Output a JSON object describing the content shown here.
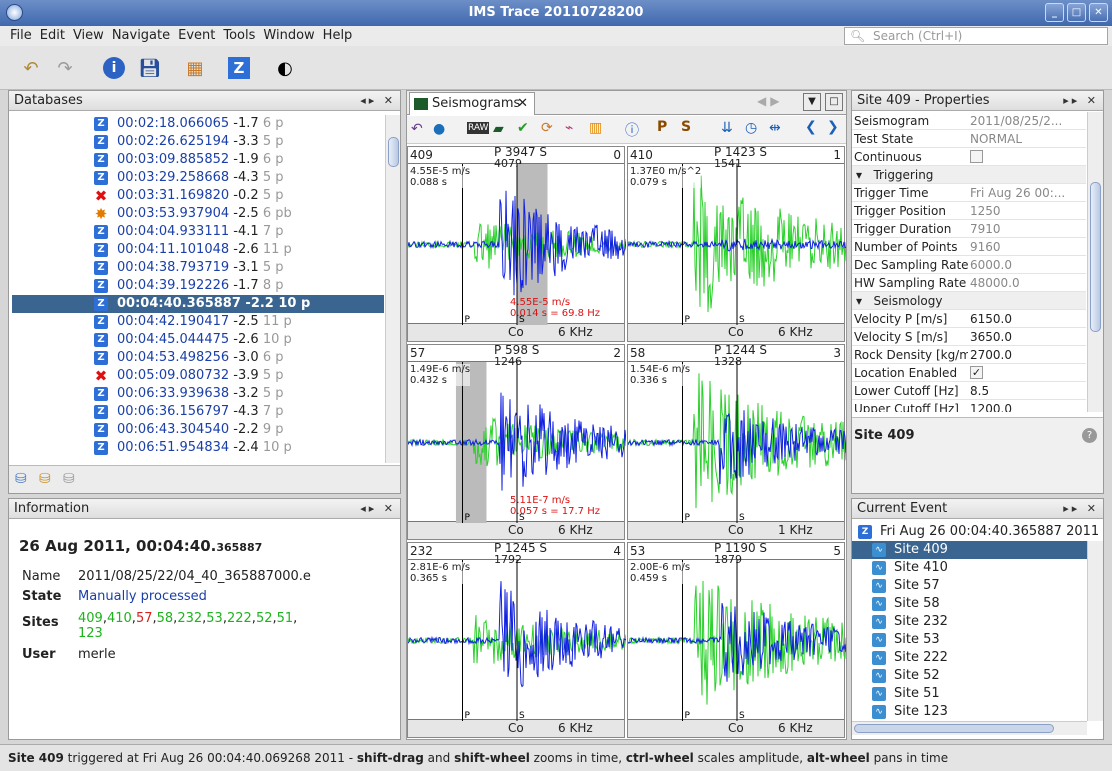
{
  "window": {
    "title": "IMS Trace 20110728200"
  },
  "menu": [
    "File",
    "Edit",
    "View",
    "Navigate",
    "Event",
    "Tools",
    "Window",
    "Help"
  ],
  "search": {
    "placeholder": "Search (Ctrl+I)"
  },
  "databases": {
    "title": "Databases",
    "rows": [
      {
        "time": "00:02:18.066065",
        "mag": "-1.7",
        "count": "6 p",
        "icon": "z"
      },
      {
        "time": "00:02:26.625194",
        "mag": "-3.3",
        "count": "5 p",
        "icon": "z"
      },
      {
        "time": "00:03:09.885852",
        "mag": "-1.9",
        "count": "6 p",
        "icon": "z"
      },
      {
        "time": "00:03:29.258668",
        "mag": "-4.3",
        "count": "5 p",
        "icon": "z"
      },
      {
        "time": "00:03:31.169820",
        "mag": "-0.2",
        "count": "5 p",
        "icon": "x"
      },
      {
        "time": "00:03:53.937904",
        "mag": "-2.5",
        "count": "6 pb",
        "icon": "b"
      },
      {
        "time": "00:04:04.933111",
        "mag": "-4.1",
        "count": "7 p",
        "icon": "z"
      },
      {
        "time": "00:04:11.101048",
        "mag": "-2.6",
        "count": "11 p",
        "icon": "z"
      },
      {
        "time": "00:04:38.793719",
        "mag": "-3.1",
        "count": "5 p",
        "icon": "z"
      },
      {
        "time": "00:04:39.192226",
        "mag": "-1.7",
        "count": "8 p",
        "icon": "z"
      },
      {
        "time": "00:04:40.365887",
        "mag": "-2.2",
        "count": "10 p",
        "icon": "z",
        "selected": true
      },
      {
        "time": "00:04:42.190417",
        "mag": "-2.5",
        "count": "11 p",
        "icon": "z"
      },
      {
        "time": "00:04:45.044475",
        "mag": "-2.6",
        "count": "10 p",
        "icon": "z"
      },
      {
        "time": "00:04:53.498256",
        "mag": "-3.0",
        "count": "6 p",
        "icon": "z"
      },
      {
        "time": "00:05:09.080732",
        "mag": "-3.9",
        "count": "5 p",
        "icon": "x"
      },
      {
        "time": "00:06:33.939638",
        "mag": "-3.2",
        "count": "5 p",
        "icon": "z"
      },
      {
        "time": "00:06:36.156797",
        "mag": "-4.3",
        "count": "7 p",
        "icon": "z"
      },
      {
        "time": "00:06:43.304540",
        "mag": "-2.2",
        "count": "9 p",
        "icon": "z"
      },
      {
        "time": "00:06:51.954834",
        "mag": "-2.4",
        "count": "10 p",
        "icon": "z"
      }
    ]
  },
  "information": {
    "title": "Information",
    "heading": "26 Aug 2011, 00:04:40.",
    "heading_small": "365887",
    "name_label": "Name",
    "name": "2011/08/25/22/04_40_365887000.e",
    "state_label": "State",
    "state": "Manually processed",
    "sites_label": "Sites",
    "sites": [
      {
        "t": "409",
        "c": "#1db31d"
      },
      {
        "t": "410",
        "c": "#1db31d"
      },
      {
        "t": "57",
        "c": "#d62020"
      },
      {
        "t": "58",
        "c": "#1db31d"
      },
      {
        "t": "232",
        "c": "#1db31d"
      },
      {
        "t": "53",
        "c": "#1db31d"
      },
      {
        "t": "222",
        "c": "#1db31d"
      },
      {
        "t": "52",
        "c": "#1db31d"
      },
      {
        "t": "51",
        "c": "#1db31d"
      },
      {
        "t": "1",
        "c": "#1db31d"
      },
      {
        "t": "23",
        "c": "#1db31d"
      }
    ],
    "user_label": "User",
    "user": "merle"
  },
  "seismograms": {
    "tab": "Seismograms",
    "plots": [
      {
        "site": "409",
        "center": "P 3947 S",
        "sub": "4079",
        "right": "0",
        "amp": "4.55E-5 m/s",
        "time": "0.088 s",
        "ann1": "4.55E-5 m/s",
        "ann2": "0.014 s = 69.8 Hz",
        "co": "Co",
        "freq": "6 KHz",
        "mode": "blue",
        "shade": [
          0.5,
          0.64
        ]
      },
      {
        "site": "410",
        "center": "P 1423 S",
        "sub": "1541",
        "right": "1",
        "amp": "1.37E0 m/s^2",
        "time": "0.079 s",
        "co": "Co",
        "freq": "6 KHz",
        "mode": "green"
      },
      {
        "site": "57",
        "center": "P 598 S",
        "sub": "1246",
        "right": "2",
        "amp": "1.49E-6 m/s",
        "time": "0.432 s",
        "ann1": "5.11E-7 m/s",
        "ann2": "0.057 s = 17.7 Hz",
        "co": "Co",
        "freq": "6 KHz",
        "mode": "blue",
        "shade": [
          0.22,
          0.36
        ]
      },
      {
        "site": "58",
        "center": "P 1244 S",
        "sub": "1328",
        "right": "3",
        "amp": "1.54E-6 m/s",
        "time": "0.336 s",
        "co": "Co",
        "freq": "1 KHz",
        "mode": "mix"
      },
      {
        "site": "232",
        "center": "P 1245 S",
        "sub": "1792",
        "right": "4",
        "amp": "2.81E-6 m/s",
        "time": "0.365 s",
        "co": "Co",
        "freq": "6 KHz",
        "mode": "blue"
      },
      {
        "site": "53",
        "center": "P 1190 S",
        "sub": "1879",
        "right": "5",
        "amp": "2.00E-6 m/s",
        "time": "0.459 s",
        "co": "Co",
        "freq": "6 KHz",
        "mode": "mix"
      }
    ]
  },
  "properties": {
    "title": "Site 409 - Properties",
    "rows": [
      {
        "k": "Seismogram",
        "v": "2011/08/25/2..."
      },
      {
        "k": "Test State",
        "v": "NORMAL"
      },
      {
        "k": "Continuous",
        "v": ""
      },
      {
        "k": "Triggering",
        "sec": true
      },
      {
        "k": "Trigger Time",
        "v": "Fri Aug 26 00:..."
      },
      {
        "k": "Trigger Position",
        "v": "1250"
      },
      {
        "k": "Trigger Duration",
        "v": "7910"
      },
      {
        "k": "Number of Points",
        "v": "9160"
      },
      {
        "k": "Dec Sampling Rate [",
        "v": "6000.0"
      },
      {
        "k": "HW Sampling Rate [H",
        "v": "48000.0"
      },
      {
        "k": "Seismology",
        "sec": true
      },
      {
        "k": "Velocity P [m/s]",
        "v": "6150.0",
        "d": true
      },
      {
        "k": "Velocity S [m/s]",
        "v": "3650.0",
        "d": true
      },
      {
        "k": "Rock Density [kg/m^",
        "v": "2700.0",
        "d": true
      },
      {
        "k": "Location Enabled",
        "v": "✓",
        "d": true
      },
      {
        "k": "Lower Cutoff [Hz]",
        "v": "8.5",
        "d": true
      },
      {
        "k": "Upper Cutoff [Hz]",
        "v": "1200.0",
        "d": true
      }
    ],
    "footer": "Site 409"
  },
  "current_event": {
    "title": "Current Event",
    "root": "Fri Aug 26 00:04:40.365887 2011",
    "sites": [
      "Site 409",
      "Site 410",
      "Site 57",
      "Site 58",
      "Site 232",
      "Site 53",
      "Site 222",
      "Site 52",
      "Site 51",
      "Site 123"
    ]
  },
  "status": {
    "site": "Site 409",
    "text1": " triggered at Fri Aug 26 00:04:40.069268 2011 - ",
    "b1": "shift-drag",
    "t2": " and ",
    "b2": "shift-wheel",
    "t3": " zooms in time, ",
    "b3": "ctrl-wheel",
    "t4": " scales amplitude, ",
    "b4": "alt-wheel",
    "t5": " pans in time"
  }
}
